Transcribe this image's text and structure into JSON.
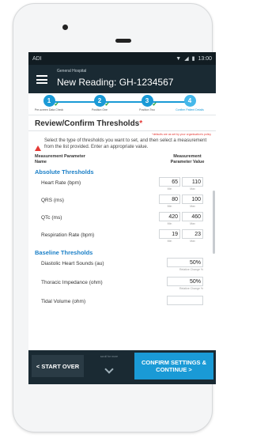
{
  "status_bar": {
    "carrier": "ADI",
    "time": "13:00"
  },
  "app_bar": {
    "hospital": "General Hospital",
    "reading_title": "New Reading: GH-1234567"
  },
  "steps": [
    {
      "number": "1",
      "label": "Pre-screen Data Check",
      "done": true
    },
    {
      "number": "2",
      "label": "Position One",
      "done": true
    },
    {
      "number": "3",
      "label": "Position Two",
      "done": true
    },
    {
      "number": "4",
      "label": "Confirm Patient Details",
      "done": false
    }
  ],
  "page": {
    "title": "Review/Confirm Thresholds",
    "required_mark": "*",
    "note": "*defaults are as set by your organisation's policy",
    "instruction": "Select the type of thresholds you want to set, and then select a measurement from the list provided.  Enter an appropriate value.",
    "col_param": "Measurement Parameter Name",
    "col_value": "Measurement Parameter Value"
  },
  "absolute": {
    "heading": "Absolute Thresholds",
    "min_label": "Min",
    "max_label": "Max",
    "rows": [
      {
        "name": "Heart Rate (bpm)",
        "min": "65",
        "max": "110"
      },
      {
        "name": "QRS (ms)",
        "min": "80",
        "max": "100"
      },
      {
        "name": "QTc (ms)",
        "min": "420",
        "max": "460"
      },
      {
        "name": "Respiration Rate (bpm)",
        "min": "19",
        "max": "23"
      }
    ]
  },
  "baseline": {
    "heading": "Baseline Thresholds",
    "change_label": "Relative Change %",
    "rows": [
      {
        "name": "Diastolic Heart Sounds (au)",
        "value": "50%"
      },
      {
        "name": "Thoracic Impedance (ohm)",
        "value": "50%"
      },
      {
        "name": "Tidal Volume (ohm)",
        "value": ""
      }
    ]
  },
  "footer": {
    "start_over": "< START OVER",
    "scroll_hint": "scroll for more",
    "confirm": "CONFIRM SETTINGS & CONTINUE >"
  },
  "colors": {
    "accent": "#1a9ad6",
    "appbar": "#1a2a33",
    "required": "#e53935",
    "section": "#1a7fc7"
  },
  "icons": [
    "menu-icon",
    "wifi-icon",
    "signal-icon",
    "battery-icon",
    "check-icon",
    "warning-icon",
    "chevron-down-icon"
  ]
}
